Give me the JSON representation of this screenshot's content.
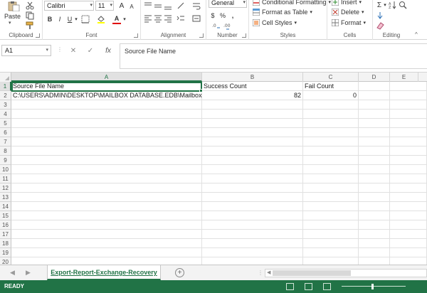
{
  "ribbon": {
    "clipboard": {
      "paste_label": "Paste",
      "group_label": "Clipboard"
    },
    "font": {
      "font_name": "Calibri",
      "font_size": "11",
      "bold_label": "B",
      "italic_label": "I",
      "underline_label": "U",
      "grow_label": "A",
      "shrink_label": "A",
      "font_color_label": "A",
      "group_label": "Font"
    },
    "alignment": {
      "group_label": "Alignment"
    },
    "number": {
      "format_value": "General",
      "currency_label": "$",
      "percent_label": "%",
      "comma_label": ",",
      "group_label": "Number"
    },
    "styles": {
      "conditional_label": "Conditional Formatting",
      "format_table_label": "Format as Table",
      "cell_styles_label": "Cell Styles",
      "group_label": "Styles"
    },
    "cells": {
      "insert_label": "Insert",
      "delete_label": "Delete",
      "format_label": "Format",
      "group_label": "Cells"
    },
    "editing": {
      "sum_label": "Σ",
      "group_label": "Editing"
    }
  },
  "formula_bar": {
    "name_box": "A1",
    "cancel_glyph": "✕",
    "enter_glyph": "✓",
    "fx_label": "fx",
    "content": "Source File Name"
  },
  "grid": {
    "columns": [
      "A",
      "B",
      "C",
      "D",
      "E"
    ],
    "rows": [
      "1",
      "2",
      "3",
      "4",
      "5",
      "6",
      "7",
      "8",
      "9",
      "10",
      "11",
      "12",
      "13",
      "14",
      "15",
      "16",
      "17",
      "18",
      "19",
      "20"
    ],
    "cells": {
      "A1": "Source File Name",
      "B1": "Success Count",
      "C1": "Fail Count",
      "A2": "C:\\USERS\\ADMIN\\DESKTOP\\MAILBOX DATABASE.EDB\\Mailbox",
      "B2": "82",
      "C2": "0"
    }
  },
  "sheets": {
    "active_tab": "Export-Report-Exchange-Recovery",
    "add_label": "+"
  },
  "status": {
    "text": "READY"
  },
  "colors": {
    "accent": "#217346",
    "header_bg": "#f3f3f3",
    "grid_line": "#e1e1e1"
  }
}
